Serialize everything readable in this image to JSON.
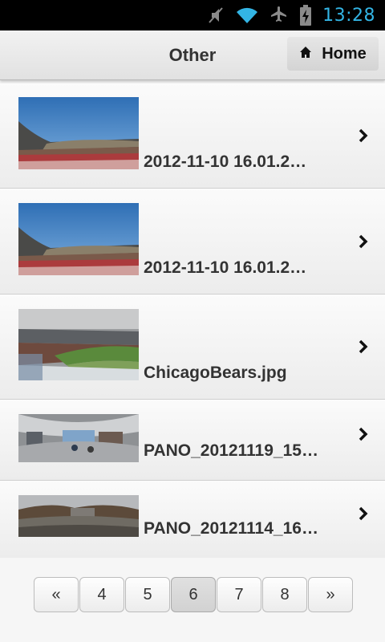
{
  "status_bar": {
    "time": "13:28",
    "icons": [
      "mute-icon",
      "wifi-icon",
      "airplane-icon",
      "battery-charging-icon"
    ],
    "time_color": "#33b5e5"
  },
  "header": {
    "title": "Other",
    "home_label": "Home",
    "home_icon": "home-icon"
  },
  "items": [
    {
      "label": "2012-11-10 16.01.2…",
      "thumb": "stadium-panorama-1"
    },
    {
      "label": "2012-11-10 16.01.2…",
      "thumb": "stadium-panorama-2"
    },
    {
      "label": "ChicagoBears.jpg",
      "thumb": "football-field-panorama"
    },
    {
      "label": "PANO_20121119_15…",
      "thumb": "office-panorama"
    },
    {
      "label": "PANO_20121114_16…",
      "thumb": "park-panorama"
    }
  ],
  "pagination": {
    "prev": "«",
    "pages": [
      "4",
      "5",
      "6",
      "7",
      "8"
    ],
    "current": "6",
    "next": "»"
  }
}
